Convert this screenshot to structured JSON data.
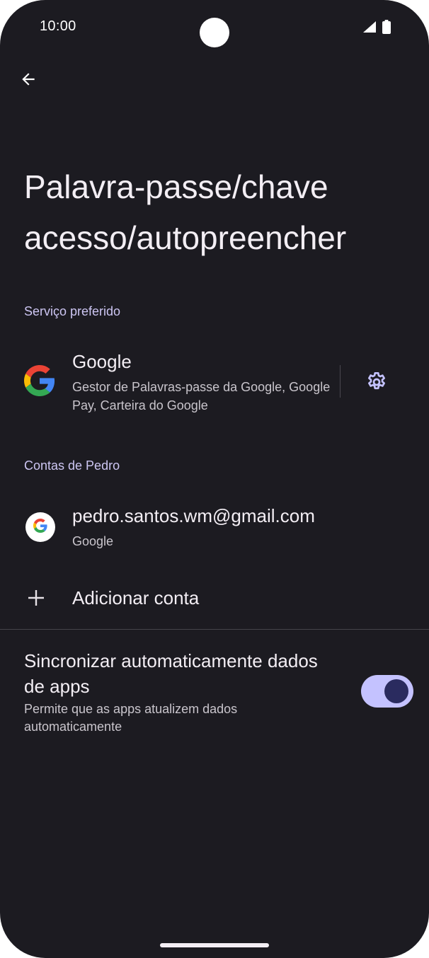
{
  "status_bar": {
    "time": "10:00",
    "icons": [
      "signal-icon",
      "battery-icon"
    ]
  },
  "navigation": {
    "back_icon": "arrow-back-icon"
  },
  "page": {
    "title": "Palavra-passe/chave acesso/autopreencher"
  },
  "preferred_service": {
    "header": "Serviço preferido",
    "provider": {
      "name": "Google",
      "description": "Gestor de Palavras-passe da Google, Google Pay, Carteira do Google",
      "icon": "google-logo-icon",
      "settings_icon": "gear-icon"
    }
  },
  "accounts": {
    "header": "Contas de Pedro",
    "items": [
      {
        "email": "pedro.santos.wm@gmail.com",
        "type": "Google"
      }
    ],
    "add_label": "Adicionar conta",
    "add_icon": "plus-icon"
  },
  "sync": {
    "title": "Sincronizar automaticamente dados de apps",
    "subtitle": "Permite que as apps atualizem dados automaticamente",
    "enabled": true
  },
  "colors": {
    "background": "#1c1b21",
    "accent": "#c4c2ff",
    "section_header": "#cdc6f3",
    "toggle_thumb": "#2a2b5f"
  }
}
